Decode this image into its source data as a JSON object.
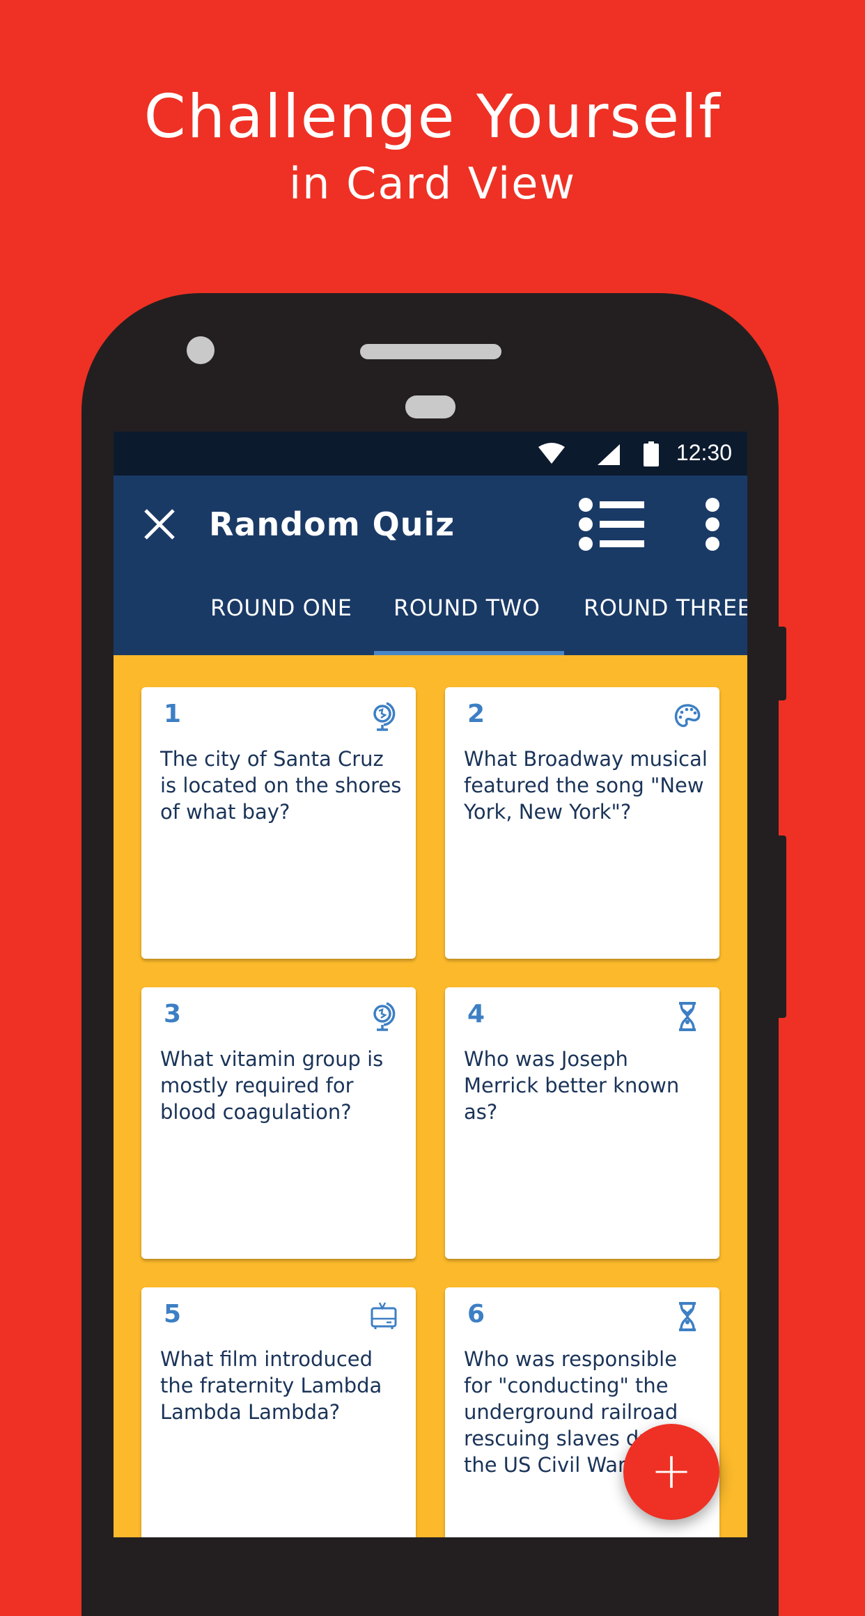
{
  "promo": {
    "title": "Challenge Yourself",
    "subtitle": "in Card View"
  },
  "status_bar": {
    "time": "12:30",
    "icons": [
      "wifi-icon",
      "cellular-signal-icon",
      "battery-icon"
    ]
  },
  "app_bar": {
    "title": "Random Quiz",
    "close_icon": "close-icon",
    "list_view_icon": "list-view-icon",
    "more_icon": "more-vert-icon"
  },
  "tabs": [
    {
      "label": "ROUND ONE",
      "selected": false
    },
    {
      "label": "ROUND TWO",
      "selected": true
    },
    {
      "label": "ROUND THREE",
      "selected": false
    }
  ],
  "cards": [
    {
      "number": "1",
      "category_icon": "globe-icon",
      "question": "The city of Santa Cruz is located on the shores of what bay?"
    },
    {
      "number": "2",
      "category_icon": "palette-icon",
      "question": "What Broadway musical featured the song \"New York, New York\"?"
    },
    {
      "number": "3",
      "category_icon": "globe-icon",
      "question": "What vitamin group is mostly required for blood coagulation?"
    },
    {
      "number": "4",
      "category_icon": "hourglass-icon",
      "question": "Who was Joseph Merrick better known as?"
    },
    {
      "number": "5",
      "category_icon": "tv-icon",
      "question": "What film introduced the fraternity Lambda Lambda Lambda?"
    },
    {
      "number": "6",
      "category_icon": "hourglass-icon",
      "question": "Who was responsible for \"conducting\" the underground railroad rescuing slaves during the US Civil War?"
    }
  ],
  "fab": {
    "label": "+",
    "icon": "add-icon"
  },
  "colors": {
    "background": "#ee3124",
    "app_bar": "#1a3a66",
    "status_bar": "#0c1a2e",
    "content_bg": "#fbb92b",
    "accent": "#3d7fc4",
    "card_text": "#1a3358",
    "fab": "#ee3124"
  }
}
